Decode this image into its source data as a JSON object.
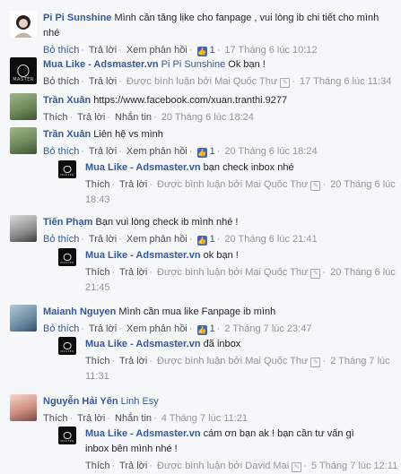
{
  "comments": [
    {
      "name": "Pi Pi Sunshine",
      "text": "Mình cần tăng lịke cho fanpage , vui lòng ib chi tiết cho mình nhé",
      "actions": {
        "unlike": "Bỏ thích",
        "reply": "Trả lời",
        "view_replies": "Xem phản hồi",
        "likes": "1",
        "time": "17 Tháng 6 lúc 10:12"
      },
      "avatar": "a-girl"
    },
    {
      "name": "Mua Like - Adsmaster.vn",
      "mention": "Pi Pi Sunshine",
      "text": "Ok bạn !",
      "actions": {
        "unlike": "Bỏ thích",
        "reply": "Trả lời",
        "posted_by": "Được bình luận bởi Mai Quốc Thư",
        "time": "17 Tháng 6 lúc 11:34"
      },
      "avatar_text": "MASTER"
    },
    {
      "name": "Trần Xuân",
      "text": "https://www.facebook.com/xuan.tranthi.9277",
      "actions": {
        "like": "Thích",
        "reply": "Trả lời",
        "message": "Nhắn tin",
        "time": "20 Tháng 6 lúc 18:24"
      }
    },
    {
      "name": "Trần Xuân",
      "text": "Liên hệ vs mình",
      "actions": {
        "unlike": "Bỏ thích",
        "reply": "Trả lời",
        "view_replies": "Xem phản hồi",
        "likes": "1",
        "time": "20 Tháng 6 lúc 18:24"
      }
    },
    {
      "name": "Mua Like - Adsmaster.vn",
      "text": "bạn check inbox nhé",
      "actions": {
        "like": "Thích",
        "reply": "Trả lời",
        "posted_by": "Được bình luận bởi Mai Quốc Thư",
        "time": "20 Tháng 6 lúc 18:43"
      },
      "avatar_text": "MASTER"
    },
    {
      "name": "Tiến Phạm",
      "text": "Bạn vui lòng check ib mình nhé !",
      "actions": {
        "unlike": "Bỏ thích",
        "reply": "Trả lời",
        "view_replies": "Xem phản hồi",
        "likes": "1",
        "time": "20 Tháng 6 lúc 21:41"
      }
    },
    {
      "name": "Mua Like - Adsmaster.vn",
      "text": "ok bạn !",
      "actions": {
        "like": "Thích",
        "reply": "Trả lời",
        "posted_by": "Được bình luận bởi Mai Quốc Thư",
        "time": "20 Tháng 6 lúc 21:45"
      },
      "avatar_text": "MASTER"
    },
    {
      "name": "Maianh Nguyen",
      "text": "Mình cần mua like Fanpage ib mình",
      "actions": {
        "unlike": "Bỏ thích",
        "reply": "Trả lời",
        "view_replies": "Xem phản hồi",
        "likes": "1",
        "time": "2 Tháng 7 lúc 23:47"
      }
    },
    {
      "name": "Mua Like - Adsmaster.vn",
      "text": "đã inbox",
      "actions": {
        "like": "Thích",
        "reply": "Trả lời",
        "posted_by": "Được bình luận bởi Mai Quốc Thư",
        "time": "2 Tháng 7 lúc 11:31"
      },
      "avatar_text": "MASTER"
    },
    {
      "name": "Nguyễn Hải Yến",
      "text": "Linh Esy",
      "actions": {
        "like": "Thích",
        "reply": "Trả lời",
        "message": "Nhắn tin",
        "time": "4 Tháng 7 lúc 11:21"
      }
    },
    {
      "name": "Mua Like - Adsmaster.vn",
      "text": "cám ơn bạn ak ! bạn cần tư vấn gì inbox bên mình nhé !",
      "actions": {
        "like": "Thích",
        "reply": "Trả lời",
        "posted_by": "Được bình luận bởi David Mai",
        "time": "5 Tháng 7 lúc 12:11"
      },
      "avatar_text": "MASTER"
    }
  ],
  "icons": {
    "like": "👍",
    "edited": "✎"
  }
}
